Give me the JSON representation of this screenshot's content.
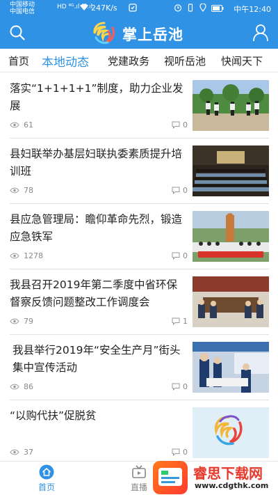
{
  "status_bar": {
    "carrier1": "中国移动",
    "carrier2": "中国电信",
    "network": "HD ⁴ᴳ.ıl ⁴ᴳ.ıl",
    "speed": "247K/s",
    "time": "中午12:40"
  },
  "header": {
    "title": "掌上岳池"
  },
  "tabs": [
    {
      "label": "首页"
    },
    {
      "label": "本地动态"
    },
    {
      "label": "党建政务"
    },
    {
      "label": "视听岳池"
    },
    {
      "label": "快闻天下"
    }
  ],
  "news": [
    {
      "title": "落实“1+1+1+1”制度，助力企业发展",
      "views": "61",
      "comments": "0",
      "thumb": "people-outdoors"
    },
    {
      "title": "县妇联举办基层妇联执委素质提升培训班",
      "views": "78",
      "comments": "0",
      "thumb": "auditorium"
    },
    {
      "title": "县应急管理局：瞻仰革命先烈，锻造应急铁军",
      "views": "1278",
      "comments": "0",
      "thumb": "monument-group"
    },
    {
      "title": "我县召开2019年第二季度中省环保督察反馈问题整改工作调度会",
      "views": "79",
      "comments": "1",
      "thumb": "meeting-room"
    },
    {
      "title": "我县举行2019年“安全生产月”街头集中宣传活动",
      "views": "86",
      "comments": "0",
      "thumb": "street-booth"
    },
    {
      "title": "“以购代扶”促脱贫",
      "views": "37",
      "comments": "0",
      "thumb": "logo-swirl"
    }
  ],
  "bottom_nav": [
    {
      "label": "首页"
    },
    {
      "label": "直播"
    }
  ],
  "watermark": {
    "text": "睿思下载网",
    "url": "www.cdgthk.com"
  },
  "colors": {
    "brand_blue": "#2f92e4",
    "watermark_red": "#e8382c"
  }
}
